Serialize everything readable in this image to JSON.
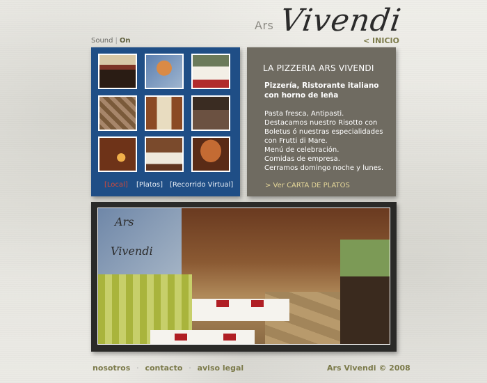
{
  "header": {
    "logo_small": "Ars",
    "logo_script": "Vivendi",
    "inicio_link": "< INICIO"
  },
  "sound": {
    "label": "Sound",
    "separator": "|",
    "state": "On"
  },
  "gallery": {
    "links": [
      {
        "label": "[Local]",
        "active": true
      },
      {
        "label": "[Platos]",
        "active": false
      },
      {
        "label": "[Recorrido Virtual]",
        "active": false
      }
    ],
    "thumbnails": [
      {
        "name": "horno-de-lena"
      },
      {
        "name": "chef-portrait"
      },
      {
        "name": "wine-glasses"
      },
      {
        "name": "mosaic-floor"
      },
      {
        "name": "framed-art"
      },
      {
        "name": "wine-bottles"
      },
      {
        "name": "oven-fire"
      },
      {
        "name": "table-setting"
      },
      {
        "name": "arch-interior"
      }
    ],
    "accent_color": "#1f4e86"
  },
  "description": {
    "title": "LA PIZZERIA ARS VIVENDI",
    "subtitle": "Pizzería, Ristorante italiano con horno de leña",
    "body_lines": [
      "Pasta fresca, Antipasti.",
      "Destacamos nuestro Risotto con",
      "Boletus ó nuestras especialidades",
      "con Frutti di Mare.",
      "Menú de celebración.",
      "Comidas de empresa.",
      "Cerramos domingo noche y lunes."
    ],
    "carta_link": "> Ver CARTA DE PLATOS",
    "panel_color": "#6f6b61"
  },
  "photo": {
    "wall_text_1": "Ars",
    "wall_text_2": "Vivendi"
  },
  "footer": {
    "links": [
      "nosotros",
      "contacto",
      "aviso legal"
    ],
    "separator": "·",
    "copyright": "Ars Vivendi © 2008"
  }
}
